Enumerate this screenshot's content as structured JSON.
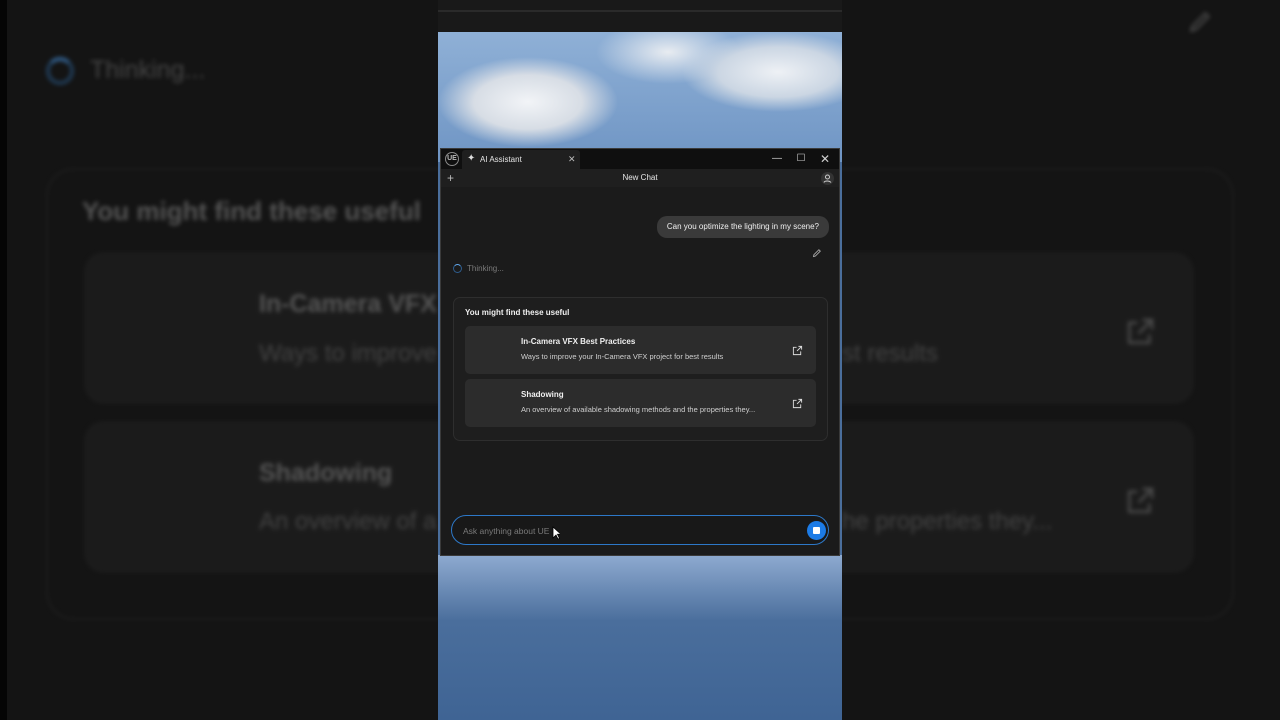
{
  "window": {
    "tab_label": "AI Assistant",
    "app_logo": "UE"
  },
  "toolbar": {
    "title": "New Chat"
  },
  "chat": {
    "user_message": "Can you optimize the lighting in my scene?",
    "status": "Thinking..."
  },
  "suggestions": {
    "title": "You might find these useful",
    "items": [
      {
        "title": "In-Camera VFX Best Practices",
        "description": "Ways to improve your In-Camera VFX project for best results"
      },
      {
        "title": "Shadowing",
        "description": "An overview of available shadowing methods and the properties they..."
      }
    ]
  },
  "input": {
    "placeholder": "Ask anything about UE"
  },
  "background": {
    "status": "Thinking...",
    "title": "You might find these useful",
    "item1_title": "In-Camera VFX",
    "item1_desc": "Ways to improve",
    "item1_desc_tail": "st results",
    "item2_title": "Shadowing",
    "item2_desc": "An overview of a",
    "item2_desc_tail": "he properties they..."
  },
  "colors": {
    "accent": "#1c7be6",
    "window_bg": "#1f1f1f",
    "card_bg": "#2c2c2c"
  }
}
